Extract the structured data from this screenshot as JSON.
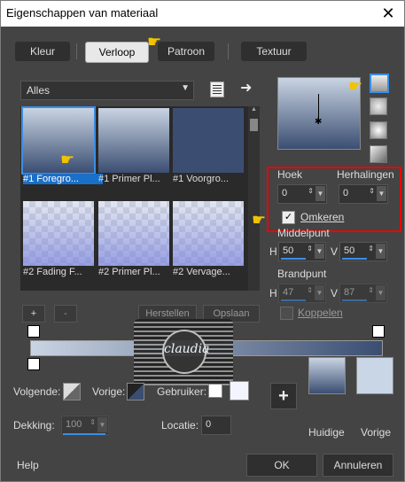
{
  "window": {
    "title": "Eigenschappen van materiaal",
    "close_glyph": "✕"
  },
  "tabs": [
    {
      "label": "Kleur",
      "active": false
    },
    {
      "label": "Verloop",
      "active": true
    },
    {
      "label": "Patroon",
      "active": false
    },
    {
      "label": "Textuur",
      "active": false
    }
  ],
  "category": {
    "value": "Alles"
  },
  "gradients": [
    {
      "caption": "#1 Foregro..."
    },
    {
      "caption": "#1 Primer Pl..."
    },
    {
      "caption": "#1 Voorgro..."
    },
    {
      "caption": "#2 Fading F..."
    },
    {
      "caption": "#2 Primer Pl..."
    },
    {
      "caption": "#2 Vervage..."
    }
  ],
  "editor_buttons": {
    "add": "+",
    "remove": "-",
    "restore": "Herstellen",
    "save": "Opslaan"
  },
  "angle": {
    "label": "Hoek",
    "value": "0"
  },
  "repeats": {
    "label": "Herhalingen",
    "value": "0"
  },
  "invert": {
    "label": "Omkeren",
    "checked": true,
    "glyph": "✓"
  },
  "center": {
    "label": "Middelpunt",
    "h_label": "H",
    "h": "50",
    "v_label": "V",
    "v": "50"
  },
  "focal": {
    "label": "Brandpunt",
    "h_label": "H",
    "h": "47",
    "v_label": "V",
    "v": "87"
  },
  "link": {
    "label": "Koppelen"
  },
  "watermark": {
    "text": "claudia"
  },
  "bottom": {
    "next_label": "Volgende:",
    "prev_label": "Vorige:",
    "user_label": "Gebruiker:",
    "opacity_label": "Dekking:",
    "opacity_value": "100",
    "location_label": "Locatie:",
    "location_value": "0",
    "add_button": "+",
    "current_label": "Huidige",
    "previous_label": "Vorige"
  },
  "footer": {
    "help": "Help",
    "ok": "OK",
    "cancel": "Annuleren"
  },
  "colors": {
    "accent": "#3a8ee6",
    "grad_top": "#c9d4e3",
    "grad_bottom": "#3b4e72",
    "highlight": "#e00000"
  }
}
